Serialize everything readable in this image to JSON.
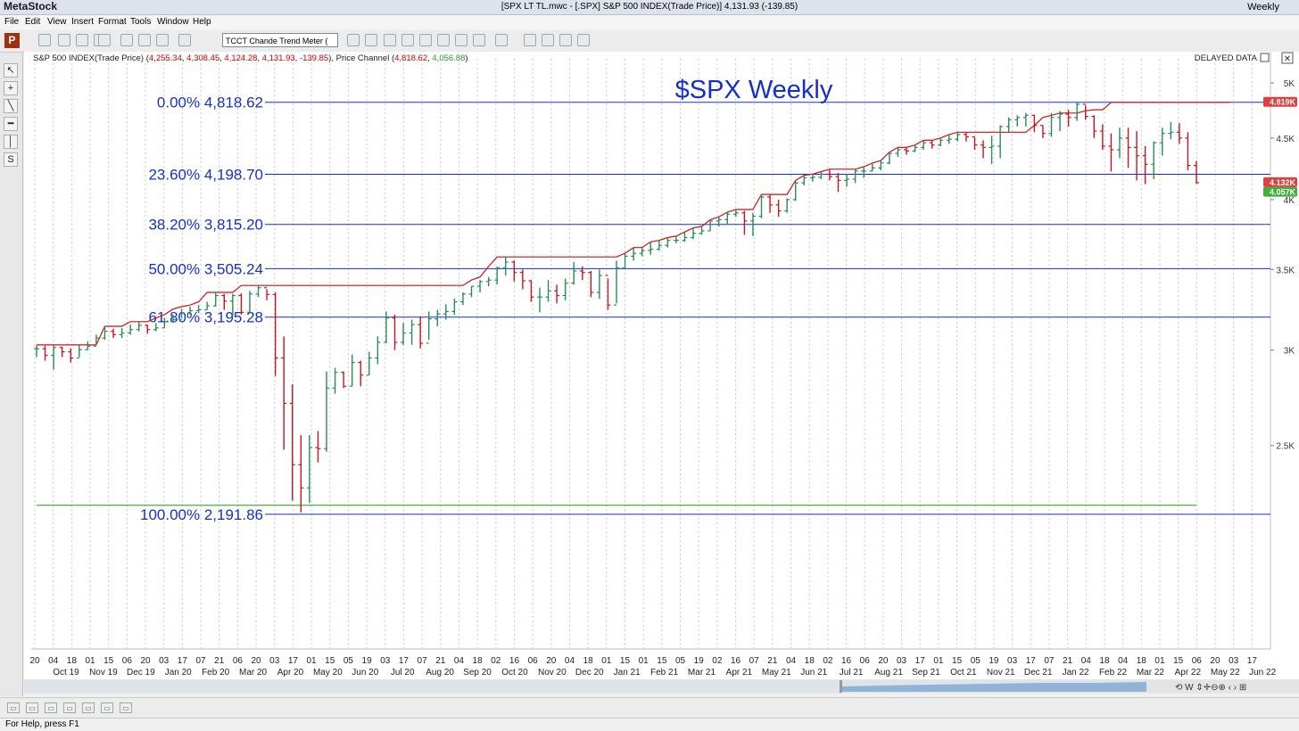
{
  "app": {
    "name": "MetaStock",
    "window_title": "[SPX LT TL.mwc - [.SPX] S&P 500 INDEX(Trade Price)]   4,131.93 (-139.85)",
    "period": "Weekly",
    "status": "For Help, press F1",
    "delayed": "DELAYED DATA"
  },
  "menu": [
    "File",
    "Edit",
    "View",
    "Insert",
    "Format",
    "Tools",
    "Window",
    "Help"
  ],
  "toolbar": {
    "expert_value": "TCCT Chande Trend Meter (",
    "logo_letter": "P",
    "icons": [
      "new-icon",
      "open-icon",
      "close-file-icon",
      "print-icon",
      "cut-icon",
      "copy-icon",
      "paste-icon",
      "undo-icon",
      "zoom-icon",
      "expert-icon",
      "indicator-icon",
      "dollar-icon",
      "explorer-icon",
      "arrow-icon",
      "system-tester-icon",
      "search-icon",
      "help-icon",
      "window-icon",
      "tile-icon",
      "cascade-icon",
      "grid-icon",
      "settings-icon"
    ]
  },
  "left_tools": [
    "pointer-icon",
    "crosshair-icon",
    "trendline-icon",
    "horizontal-line-icon",
    "vertical-line-icon",
    "text-tool-icon"
  ],
  "chart": {
    "header": {
      "name": "S&P 500 INDEX(Trade Price)",
      "o": "4,255.34",
      "h": "4,308.45",
      "l": "4,124.28",
      "c": "4,131.93",
      "chg": "-139.85",
      "channel_name": "Price Channel",
      "channel_hi": "4,818.62",
      "channel_lo": "4,056.88"
    },
    "title": "$SPX Weekly",
    "colors": {
      "up": "#2a8a5a",
      "down": "#c8141e",
      "channel_hi": "#d01010",
      "channel_lo": "#3aa030",
      "fib": "#1530c8",
      "title": "#1530c8"
    }
  },
  "chart_data": {
    "type": "ohlc",
    "title": "$SPX Weekly",
    "ylim": [
      1700,
      5200
    ],
    "y_ticks": [
      {
        "label": "5K",
        "value": 5000
      },
      {
        "label": "4.5K",
        "value": 4500
      },
      {
        "label": "4K",
        "value": 4000
      },
      {
        "label": "3.5K",
        "value": 3500
      },
      {
        "label": "3K",
        "value": 3000
      },
      {
        "label": "2.5K",
        "value": 2500
      }
    ],
    "price_tags": [
      {
        "label": "4.819K",
        "value": 4818.62,
        "color": "#e04040"
      },
      {
        "label": "4.132K",
        "value": 4131.93,
        "color": "#e04040"
      },
      {
        "label": "4.057K",
        "value": 4056.88,
        "color": "#40b040"
      }
    ],
    "fib_levels": [
      {
        "label": "0.00% 4,818.62",
        "value": 4818.62
      },
      {
        "label": "23.60% 4,198.70",
        "value": 4198.7
      },
      {
        "label": "38.20% 3,815.20",
        "value": 3815.2
      },
      {
        "label": "50.00% 3,505.24",
        "value": 3505.24
      },
      {
        "label": "61.80% 3,195.28",
        "value": 3195.28
      },
      {
        "label": "100.00% 2,191.86",
        "value": 2191.86
      }
    ],
    "x_day_labels": [
      "20",
      "04",
      "18",
      "01",
      "15",
      "06",
      "20",
      "03",
      "17",
      "07",
      "21",
      "06",
      "20",
      "03",
      "17",
      "01",
      "15",
      "05",
      "19",
      "03",
      "17",
      "07",
      "21",
      "04",
      "18",
      "02",
      "16",
      "06",
      "20",
      "04",
      "18",
      "01",
      "15",
      "01",
      "15",
      "05",
      "19",
      "02",
      "16",
      "07",
      "21",
      "04",
      "18",
      "02",
      "16",
      "06",
      "20",
      "03",
      "17",
      "01",
      "15",
      "05",
      "19",
      "03",
      "17",
      "07",
      "21",
      "04",
      "18",
      "04",
      "18",
      "01",
      "15",
      "06",
      "20",
      "03",
      "17"
    ],
    "x_month_labels": [
      "Oct 19",
      "Nov 19",
      "Dec 19",
      "Jan 20",
      "Feb 20",
      "Mar 20",
      "Apr 20",
      "May 20",
      "Jun 20",
      "Jul 20",
      "Aug 20",
      "Sep 20",
      "Oct 20",
      "Nov 20",
      "Dec 20",
      "Jan 21",
      "Feb 21",
      "Mar 21",
      "Apr 21",
      "May 21",
      "Jun 21",
      "Jul 21",
      "Aug 21",
      "Sep 21",
      "Oct 21",
      "Nov 21",
      "Dec 21",
      "Jan 22",
      "Feb 22",
      "Mar 22",
      "Apr 22",
      "May 22",
      "Jun 22"
    ],
    "closes": [
      3008,
      2970,
      3015,
      2990,
      2955,
      3003,
      3022,
      3070,
      3110,
      3090,
      3100,
      3120,
      3146,
      3120,
      3130,
      3168,
      3180,
      3221,
      3235,
      3240,
      3265,
      3330,
      3295,
      3330,
      3225,
      3340,
      3380,
      3337,
      2955,
      2710,
      2410,
      2305,
      2490,
      2485,
      2790,
      2875,
      2800,
      2930,
      2860,
      2955,
      3045,
      3190,
      3045,
      3100,
      3150,
      3040,
      3185,
      3215,
      3230,
      3290,
      3340,
      3390,
      3420,
      3430,
      3510,
      3550,
      3480,
      3425,
      3320,
      3320,
      3360,
      3330,
      3410,
      3490,
      3480,
      3350,
      3460,
      3270,
      3510,
      3590,
      3610,
      3630,
      3638,
      3665,
      3700,
      3700,
      3720,
      3750,
      3768,
      3840,
      3850,
      3890,
      3900,
      3840,
      3875,
      4020,
      3960,
      3915,
      4000,
      4130,
      4170,
      4175,
      4200,
      4180,
      4150,
      4160,
      4225,
      4225,
      4250,
      4290,
      4370,
      4400,
      4390,
      4420,
      4460,
      4440,
      4480,
      4490,
      4530,
      4510,
      4440,
      4420,
      4430,
      4600,
      4660,
      4680,
      4700,
      4610,
      4540,
      4680,
      4710,
      4680,
      4800,
      4690,
      4560,
      4430,
      4400,
      4500,
      4420,
      4350,
      4280,
      4460,
      4540,
      4550,
      4500,
      4270,
      4132
    ],
    "highs": [
      3028,
      3025,
      3030,
      3020,
      3010,
      3030,
      3050,
      3090,
      3140,
      3125,
      3130,
      3150,
      3168,
      3150,
      3160,
      3190,
      3210,
      3245,
      3260,
      3270,
      3290,
      3350,
      3340,
      3340,
      3345,
      3360,
      3395,
      3370,
      3350,
      3080,
      2810,
      2550,
      2550,
      2570,
      2880,
      2900,
      2880,
      2975,
      2940,
      2990,
      3080,
      3230,
      3210,
      3160,
      3180,
      3200,
      3230,
      3240,
      3275,
      3310,
      3350,
      3390,
      3430,
      3450,
      3520,
      3585,
      3560,
      3500,
      3430,
      3380,
      3430,
      3400,
      3440,
      3550,
      3520,
      3490,
      3500,
      3440,
      3560,
      3610,
      3650,
      3650,
      3690,
      3700,
      3720,
      3730,
      3760,
      3790,
      3800,
      3850,
      3870,
      3905,
      3925,
      3915,
      3900,
      4040,
      4040,
      4000,
      4010,
      4150,
      4190,
      4200,
      4220,
      4240,
      4210,
      4200,
      4240,
      4260,
      4290,
      4310,
      4380,
      4420,
      4420,
      4440,
      4480,
      4480,
      4500,
      4530,
      4550,
      4550,
      4510,
      4480,
      4520,
      4610,
      4680,
      4700,
      4720,
      4705,
      4610,
      4720,
      4740,
      4750,
      4818,
      4790,
      4700,
      4620,
      4540,
      4590,
      4590,
      4560,
      4430,
      4470,
      4590,
      4640,
      4630,
      4550,
      4307
    ],
    "lows": [
      2960,
      2940,
      2890,
      2960,
      2930,
      2960,
      3000,
      3030,
      3060,
      3070,
      3070,
      3090,
      3110,
      3095,
      3110,
      3130,
      3160,
      3190,
      3210,
      3220,
      3240,
      3260,
      3240,
      3200,
      3210,
      3220,
      3320,
      3300,
      2855,
      2480,
      2250,
      2200,
      2240,
      2420,
      2470,
      2760,
      2790,
      2800,
      2800,
      2860,
      2920,
      3040,
      3000,
      3030,
      3030,
      3010,
      3060,
      3140,
      3180,
      3210,
      3270,
      3320,
      3350,
      3390,
      3400,
      3460,
      3420,
      3370,
      3290,
      3225,
      3290,
      3280,
      3300,
      3400,
      3430,
      3320,
      3310,
      3240,
      3280,
      3510,
      3560,
      3590,
      3600,
      3630,
      3650,
      3680,
      3690,
      3710,
      3740,
      3770,
      3800,
      3820,
      3870,
      3740,
      3730,
      3860,
      3900,
      3870,
      3900,
      3990,
      4110,
      4140,
      4160,
      4150,
      4060,
      4100,
      4130,
      4170,
      4220,
      4230,
      4280,
      4340,
      4360,
      4380,
      4400,
      4410,
      4430,
      4450,
      4470,
      4470,
      4400,
      4330,
      4280,
      4330,
      4550,
      4600,
      4600,
      4550,
      4500,
      4510,
      4560,
      4600,
      4650,
      4660,
      4500,
      4400,
      4220,
      4330,
      4250,
      4150,
      4120,
      4160,
      4350,
      4490,
      4450,
      4230,
      4124
    ],
    "channel_hi": [
      3030,
      3030,
      3030,
      3030,
      3030,
      3030,
      3030,
      3030,
      3140,
      3140,
      3140,
      3168,
      3168,
      3168,
      3190,
      3210,
      3245,
      3260,
      3270,
      3290,
      3350,
      3350,
      3350,
      3350,
      3395,
      3395,
      3395,
      3395,
      3395,
      3395,
      3395,
      3395,
      3395,
      3395,
      3395,
      3395,
      3395,
      3395,
      3395,
      3395,
      3395,
      3395,
      3395,
      3395,
      3395,
      3395,
      3395,
      3395,
      3395,
      3395,
      3395,
      3430,
      3450,
      3520,
      3585,
      3585,
      3585,
      3585,
      3585,
      3585,
      3585,
      3585,
      3585,
      3585,
      3585,
      3585,
      3585,
      3585,
      3585,
      3610,
      3650,
      3650,
      3690,
      3700,
      3720,
      3730,
      3760,
      3790,
      3800,
      3850,
      3870,
      3905,
      3925,
      3925,
      3925,
      4040,
      4040,
      4040,
      4040,
      4150,
      4190,
      4200,
      4220,
      4240,
      4240,
      4240,
      4240,
      4260,
      4290,
      4310,
      4380,
      4420,
      4420,
      4440,
      4480,
      4480,
      4500,
      4530,
      4550,
      4550,
      4550,
      4550,
      4550,
      4550,
      4550,
      4550,
      4550,
      4610,
      4680,
      4700,
      4720,
      4720,
      4720,
      4740,
      4750,
      4750,
      4818,
      4818,
      4818,
      4818,
      4818,
      4818,
      4818,
      4818,
      4818,
      4818,
      4818,
      4818,
      4818,
      4818,
      4818
    ],
    "channel_lo": [
      2230,
      2230,
      2230,
      2230,
      2230,
      2230,
      2230,
      2230,
      2230,
      2230,
      2230,
      2230,
      2230,
      2230,
      2230,
      2230,
      2230,
      2230,
      2230,
      2230,
      2230,
      2230,
      2230,
      2230,
      2230,
      2230,
      2230,
      2230,
      2230,
      2230,
      2230,
      2230,
      2230,
      2230,
      2230,
      2230,
      2230,
      2230,
      2230,
      2230,
      2230,
      2230,
      2230,
      2230,
      2230,
      2230,
      2230,
      2230,
      2230,
      2230,
      2230,
      2230,
      2230,
      2230,
      2230,
      2230,
      2230,
      2230,
      2230,
      2230,
      2230,
      2230,
      2230,
      2230,
      2230,
      2230,
      2230,
      2230,
      2230,
      2230,
      2230,
      2230,
      2230,
      2230,
      2230,
      2230,
      2230,
      2230,
      2230,
      2230,
      2230,
      2230,
      2230,
      2230,
      2230,
      2230,
      2230,
      2230,
      2230,
      2230,
      2230,
      2230,
      2230,
      2230,
      2230,
      2230,
      2230,
      2230,
      2230,
      2230,
      2230,
      2230,
      2230,
      2230,
      2230,
      2230,
      2230,
      2230,
      2230,
      2230,
      2230,
      2230,
      2230,
      2230,
      2230,
      2230,
      2230,
      2230,
      2230,
      2230,
      2230,
      2230,
      2230,
      2230,
      2230,
      2230,
      2230,
      2230,
      2230,
      2230,
      2230,
      2230,
      2230,
      2230,
      2230,
      2230,
      2230
    ]
  },
  "footer_buttons": [
    "zoom-1-icon",
    "zoom-2-icon",
    "zoom-3-icon",
    "zoom-4-icon",
    "zoom-5-icon",
    "zoom-6-icon",
    "zoom-7-icon"
  ]
}
